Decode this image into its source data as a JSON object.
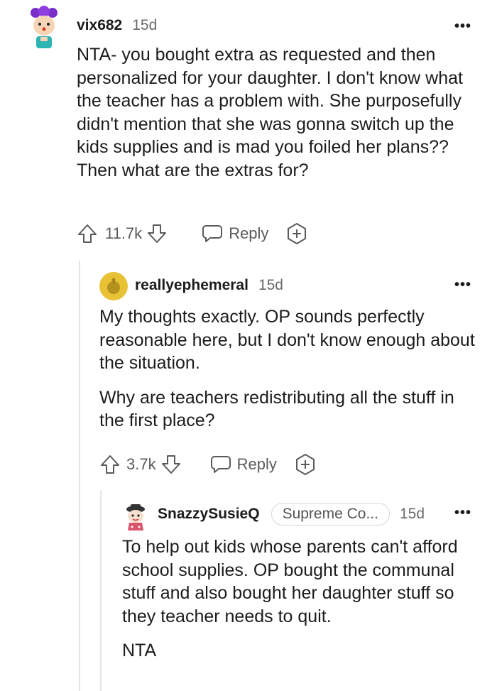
{
  "comments": [
    {
      "username": "vix682",
      "time": "15d",
      "text": [
        "NTA- you bought extra as requested and then personalized for your daughter. I don't know what the teacher has a problem with. She purposefully didn't mention that she was gonna switch up the kids supplies and is mad you foiled her plans?? Then what are the extras for?"
      ],
      "votes": "11.7k",
      "reply_label": "Reply",
      "more": "•••"
    },
    {
      "username": "reallyephemeral",
      "time": "15d",
      "text": [
        "My thoughts exactly. OP sounds perfectly reasonable here, but I don't know enough about the situation.",
        "Why are teachers redistributing all the stuff in the first place?"
      ],
      "votes": "3.7k",
      "reply_label": "Reply",
      "more": "•••"
    },
    {
      "username": "SnazzySusieQ",
      "flair": "Supreme Co...",
      "time": "15d",
      "text": [
        "To help out kids whose parents can't afford school supplies. OP bought the communal stuff and also bought her daughter stuff so they teacher needs to quit.",
        "NTA"
      ],
      "more": "•••"
    }
  ],
  "icons": {
    "upvote": "upvote-arrow-icon",
    "downvote": "downvote-arrow-icon",
    "reply": "speech-bubble-icon",
    "award": "award-plus-icon",
    "more": "more-dots-icon"
  }
}
